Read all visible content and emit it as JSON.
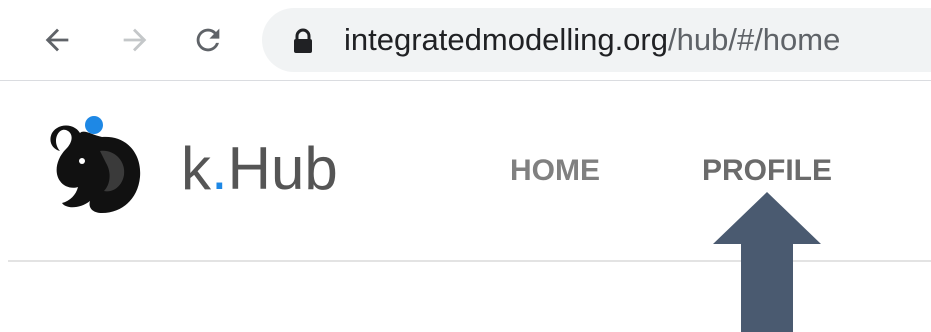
{
  "browser": {
    "url_host": "integratedmodelling.org",
    "url_path": "/hub/#/home",
    "icons": {
      "back": "arrow-back-icon",
      "forward": "arrow-forward-icon",
      "reload": "reload-icon",
      "lock": "lock-icon"
    }
  },
  "site": {
    "brand_prefix": "k",
    "brand_dot": ".",
    "brand_suffix": "Hub",
    "logo": "k-hub-elephant-logo",
    "menu": [
      {
        "label": "HOME"
      },
      {
        "label": "PROFILE"
      }
    ]
  },
  "annotation": {
    "arrow": "up-arrow-pointer",
    "color": "#4a5a70"
  },
  "colors": {
    "accent": "#1e88e5",
    "omnibox": "#f1f3f4"
  }
}
